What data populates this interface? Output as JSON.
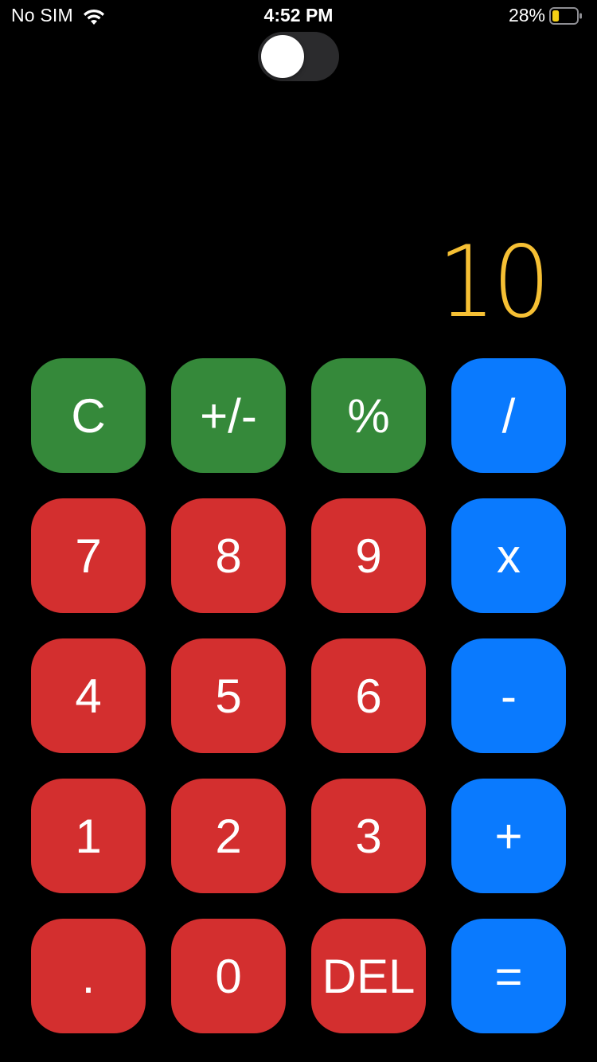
{
  "status_bar": {
    "carrier": "No SIM",
    "time": "4:52 PM",
    "battery_percent": "28%",
    "wifi_icon": "wifi-icon",
    "battery_icon": "battery-icon",
    "battery_level": 0.28,
    "battery_color": "#f6d215"
  },
  "toggle": {
    "state": "off",
    "track_color": "#2b2b2d"
  },
  "display": {
    "value": "10",
    "color": "#f6c034"
  },
  "keys": {
    "clear": "C",
    "sign": "+/-",
    "percent": "%",
    "divide": "/",
    "seven": "7",
    "eight": "8",
    "nine": "9",
    "multiply": "x",
    "four": "4",
    "five": "5",
    "six": "6",
    "subtract": "-",
    "one": "1",
    "two": "2",
    "three": "3",
    "add": "+",
    "decimal": ".",
    "zero": "0",
    "delete": "DEL",
    "equals": "="
  },
  "colors": {
    "function_keys": "#35893a",
    "number_keys": "#d32f2f",
    "operator_keys": "#0a7afe",
    "background": "#000000"
  }
}
